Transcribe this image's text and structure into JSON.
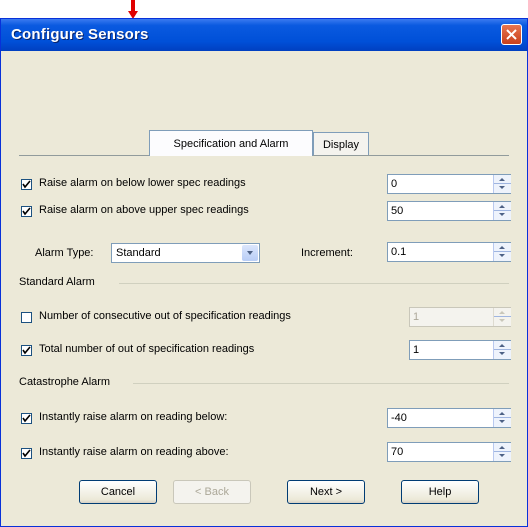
{
  "window": {
    "title": "Configure Sensors"
  },
  "tabs": [
    {
      "label": "Specification and Alarm",
      "active": true
    },
    {
      "label": "Display",
      "active": false
    }
  ],
  "spec": {
    "lower": {
      "label": "Raise alarm on below lower spec readings",
      "checked": true,
      "value": "0"
    },
    "upper": {
      "label": "Raise alarm on above upper spec readings",
      "checked": true,
      "value": "50"
    },
    "alarm_type_label": "Alarm Type:",
    "alarm_type_value": "Standard",
    "increment_label": "Increment:",
    "increment_value": "0.1"
  },
  "standard_alarm": {
    "header": "Standard Alarm",
    "consecutive": {
      "label": "Number of consecutive out of specification readings",
      "checked": false,
      "value": "1",
      "enabled": false
    },
    "total": {
      "label": "Total number of out of specification readings",
      "checked": true,
      "value": "1"
    }
  },
  "catastrophe_alarm": {
    "header": "Catastrophe Alarm",
    "below": {
      "label": "Instantly raise alarm on reading below:",
      "checked": true,
      "value": "-40"
    },
    "above": {
      "label": "Instantly raise alarm on reading above:",
      "checked": true,
      "value": "70"
    }
  },
  "buttons": {
    "cancel": "Cancel",
    "back": "< Back",
    "next": "Next >",
    "help": "Help"
  },
  "colors": {
    "title_bar": "#0050d8",
    "dialog_bg": "#ece9d8",
    "marker_arrow": "#e00000",
    "close_button": "#c8401c"
  }
}
